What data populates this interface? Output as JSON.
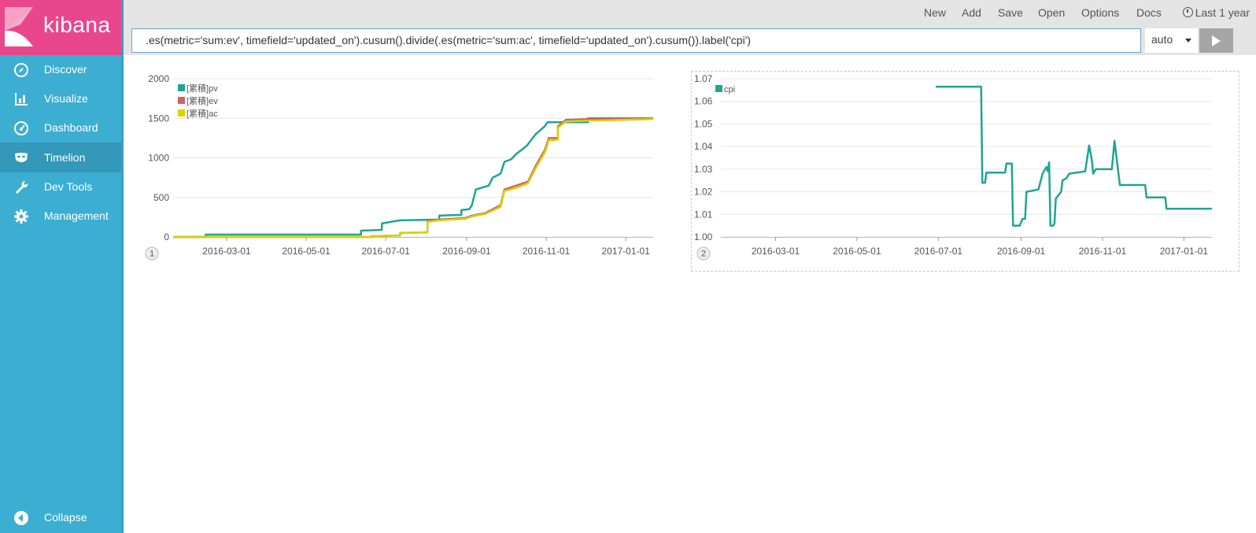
{
  "app": {
    "brand": "kibana"
  },
  "sidebar": {
    "items": [
      {
        "label": "Discover",
        "icon": "compass-icon"
      },
      {
        "label": "Visualize",
        "icon": "bar-chart-icon"
      },
      {
        "label": "Dashboard",
        "icon": "gauge-icon"
      },
      {
        "label": "Timelion",
        "icon": "mask-icon",
        "active": true
      },
      {
        "label": "Dev Tools",
        "icon": "wrench-icon"
      },
      {
        "label": "Management",
        "icon": "gear-icon"
      }
    ],
    "collapse": "Collapse"
  },
  "topbar": {
    "menu": [
      "New",
      "Add",
      "Save",
      "Open",
      "Options",
      "Docs"
    ],
    "time": "Last 1 year"
  },
  "query": {
    "expression": ".es(metric='sum:ev', timefield='updated_on').cusum().divide(.es(metric='sum:ac', timefield='updated_on').cusum()).label('cpi')",
    "interval": "auto"
  },
  "colors": {
    "teal": "#1ea593",
    "red": "#d36069",
    "yellow": "#d4d400",
    "sidebar": "#3caed2",
    "brand": "#e8488b"
  },
  "chart_data": [
    {
      "type": "line",
      "panel_number": "1",
      "x_type": "date",
      "xlim": [
        "2016-01-20",
        "2017-01-22"
      ],
      "xticks": [
        "2016-03-01",
        "2016-05-01",
        "2016-07-01",
        "2016-09-01",
        "2016-11-01",
        "2017-01-01"
      ],
      "ylim": [
        0,
        2000
      ],
      "yticks": [
        0,
        500,
        1000,
        1500,
        2000
      ],
      "legend": "top-left",
      "grid": true,
      "series": [
        {
          "name": "[累積]pv",
          "color": "#1ea593",
          "points": [
            [
              "2016-01-20",
              0
            ],
            [
              "2016-02-14",
              0
            ],
            [
              "2016-02-14",
              30
            ],
            [
              "2016-06-12",
              30
            ],
            [
              "2016-06-12",
              80
            ],
            [
              "2016-06-28",
              90
            ],
            [
              "2016-06-28",
              170
            ],
            [
              "2016-07-08",
              200
            ],
            [
              "2016-07-12",
              210
            ],
            [
              "2016-08-11",
              220
            ],
            [
              "2016-08-11",
              270
            ],
            [
              "2016-08-28",
              280
            ],
            [
              "2016-08-28",
              340
            ],
            [
              "2016-09-03",
              350
            ],
            [
              "2016-09-05",
              400
            ],
            [
              "2016-09-08",
              600
            ],
            [
              "2016-09-18",
              650
            ],
            [
              "2016-09-21",
              750
            ],
            [
              "2016-09-27",
              800
            ],
            [
              "2016-09-30",
              950
            ],
            [
              "2016-10-05",
              980
            ],
            [
              "2016-10-09",
              1050
            ],
            [
              "2016-10-17",
              1150
            ],
            [
              "2016-10-24",
              1300
            ],
            [
              "2016-10-31",
              1400
            ],
            [
              "2016-11-02",
              1450
            ],
            [
              "2016-12-03",
              1450
            ],
            [
              "2016-12-03",
              1500
            ],
            [
              "2017-01-22",
              1500
            ]
          ]
        },
        {
          "name": "[累積]ev",
          "color": "#d36069",
          "points": [
            [
              "2016-01-20",
              0
            ],
            [
              "2016-06-20",
              0
            ],
            [
              "2016-06-20",
              10
            ],
            [
              "2016-07-12",
              20
            ],
            [
              "2016-07-12",
              50
            ],
            [
              "2016-08-02",
              60
            ],
            [
              "2016-08-02",
              200
            ],
            [
              "2016-08-11",
              220
            ],
            [
              "2016-08-31",
              240
            ],
            [
              "2016-09-03",
              260
            ],
            [
              "2016-09-08",
              280
            ],
            [
              "2016-09-15",
              300
            ],
            [
              "2016-09-27",
              400
            ],
            [
              "2016-09-30",
              600
            ],
            [
              "2016-10-09",
              650
            ],
            [
              "2016-10-18",
              700
            ],
            [
              "2016-10-24",
              900
            ],
            [
              "2016-10-31",
              1100
            ],
            [
              "2016-11-03",
              1250
            ],
            [
              "2016-11-10",
              1250
            ],
            [
              "2016-11-10",
              1400
            ],
            [
              "2016-11-16",
              1480
            ],
            [
              "2016-12-03",
              1490
            ],
            [
              "2017-01-22",
              1500
            ]
          ]
        },
        {
          "name": "[累積]ac",
          "color": "#d4d400",
          "points": [
            [
              "2016-01-20",
              0
            ],
            [
              "2016-06-20",
              0
            ],
            [
              "2016-06-20",
              10
            ],
            [
              "2016-07-12",
              20
            ],
            [
              "2016-07-12",
              50
            ],
            [
              "2016-08-02",
              60
            ],
            [
              "2016-08-02",
              190
            ],
            [
              "2016-08-11",
              210
            ],
            [
              "2016-08-31",
              230
            ],
            [
              "2016-09-03",
              250
            ],
            [
              "2016-09-08",
              270
            ],
            [
              "2016-09-15",
              290
            ],
            [
              "2016-09-27",
              380
            ],
            [
              "2016-09-30",
              580
            ],
            [
              "2016-10-09",
              620
            ],
            [
              "2016-10-18",
              680
            ],
            [
              "2016-10-24",
              870
            ],
            [
              "2016-10-31",
              1070
            ],
            [
              "2016-11-03",
              1220
            ],
            [
              "2016-11-10",
              1230
            ],
            [
              "2016-11-10",
              1380
            ],
            [
              "2016-11-16",
              1460
            ],
            [
              "2016-12-03",
              1470
            ],
            [
              "2017-01-22",
              1490
            ]
          ]
        }
      ]
    },
    {
      "type": "line",
      "panel_number": "2",
      "x_type": "date",
      "xlim": [
        "2016-01-20",
        "2017-01-22"
      ],
      "xticks": [
        "2016-03-01",
        "2016-05-01",
        "2016-07-01",
        "2016-09-01",
        "2016-11-01",
        "2017-01-01"
      ],
      "ylim": [
        1.0,
        1.07
      ],
      "yticks": [
        1.0,
        1.01,
        1.02,
        1.03,
        1.04,
        1.05,
        1.06,
        1.07
      ],
      "legend": "top-left",
      "grid": true,
      "series": [
        {
          "name": "cpi",
          "color": "#1ea593",
          "points": [
            [
              "2016-06-29",
              1.0665
            ],
            [
              "2016-08-02",
              1.0665
            ],
            [
              "2016-08-03",
              1.024
            ],
            [
              "2016-08-05",
              1.024
            ],
            [
              "2016-08-06",
              1.0285
            ],
            [
              "2016-08-20",
              1.0285
            ],
            [
              "2016-08-21",
              1.0325
            ],
            [
              "2016-08-25",
              1.0325
            ],
            [
              "2016-08-26",
              1.005
            ],
            [
              "2016-08-31",
              1.005
            ],
            [
              "2016-09-02",
              1.008
            ],
            [
              "2016-09-04",
              1.008
            ],
            [
              "2016-09-05",
              1.02
            ],
            [
              "2016-09-14",
              1.021
            ],
            [
              "2016-09-17",
              1.028
            ],
            [
              "2016-09-20",
              1.031
            ],
            [
              "2016-09-21",
              1.029
            ],
            [
              "2016-09-22",
              1.033
            ],
            [
              "2016-09-23",
              1.005
            ],
            [
              "2016-09-25",
              1.005
            ],
            [
              "2016-09-26",
              1.006
            ],
            [
              "2016-09-27",
              1.017
            ],
            [
              "2016-10-01",
              1.02
            ],
            [
              "2016-10-02",
              1.025
            ],
            [
              "2016-10-05",
              1.026
            ],
            [
              "2016-10-07",
              1.028
            ],
            [
              "2016-10-19",
              1.029
            ],
            [
              "2016-10-22",
              1.0405
            ],
            [
              "2016-10-24",
              1.034
            ],
            [
              "2016-10-25",
              1.028
            ],
            [
              "2016-10-27",
              1.03
            ],
            [
              "2016-11-08",
              1.03
            ],
            [
              "2016-11-10",
              1.0425
            ],
            [
              "2016-11-14",
              1.023
            ],
            [
              "2016-12-03",
              1.023
            ],
            [
              "2016-12-04",
              1.0175
            ],
            [
              "2016-12-18",
              1.0175
            ],
            [
              "2016-12-19",
              1.0125
            ],
            [
              "2017-01-22",
              1.0125
            ]
          ]
        }
      ]
    }
  ]
}
